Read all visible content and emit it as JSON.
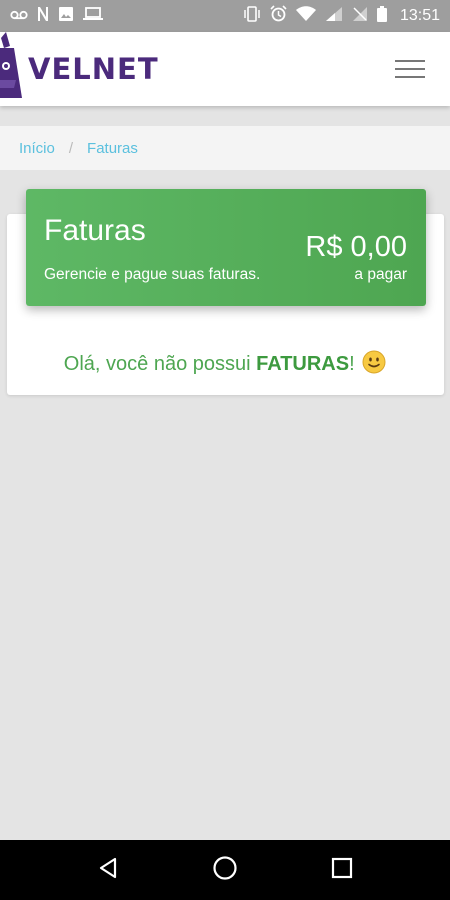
{
  "status_bar": {
    "time": "13:51"
  },
  "app": {
    "logo_text": "VELNET"
  },
  "breadcrumb": {
    "home": "Início",
    "separator": "/",
    "current": "Faturas"
  },
  "invoices_card": {
    "title": "Faturas",
    "subtitle": "Gerencie e pague suas faturas.",
    "amount": "R$ 0,00",
    "amount_label": "a pagar",
    "empty_prefix": "Olá, você não possui ",
    "empty_emphasis": "FATURAS",
    "empty_suffix": "! ",
    "empty_icon": "smiley-icon"
  },
  "colors": {
    "green": "#4ea651",
    "brand_purple": "#4b2a7c",
    "link": "#5bc0de"
  }
}
